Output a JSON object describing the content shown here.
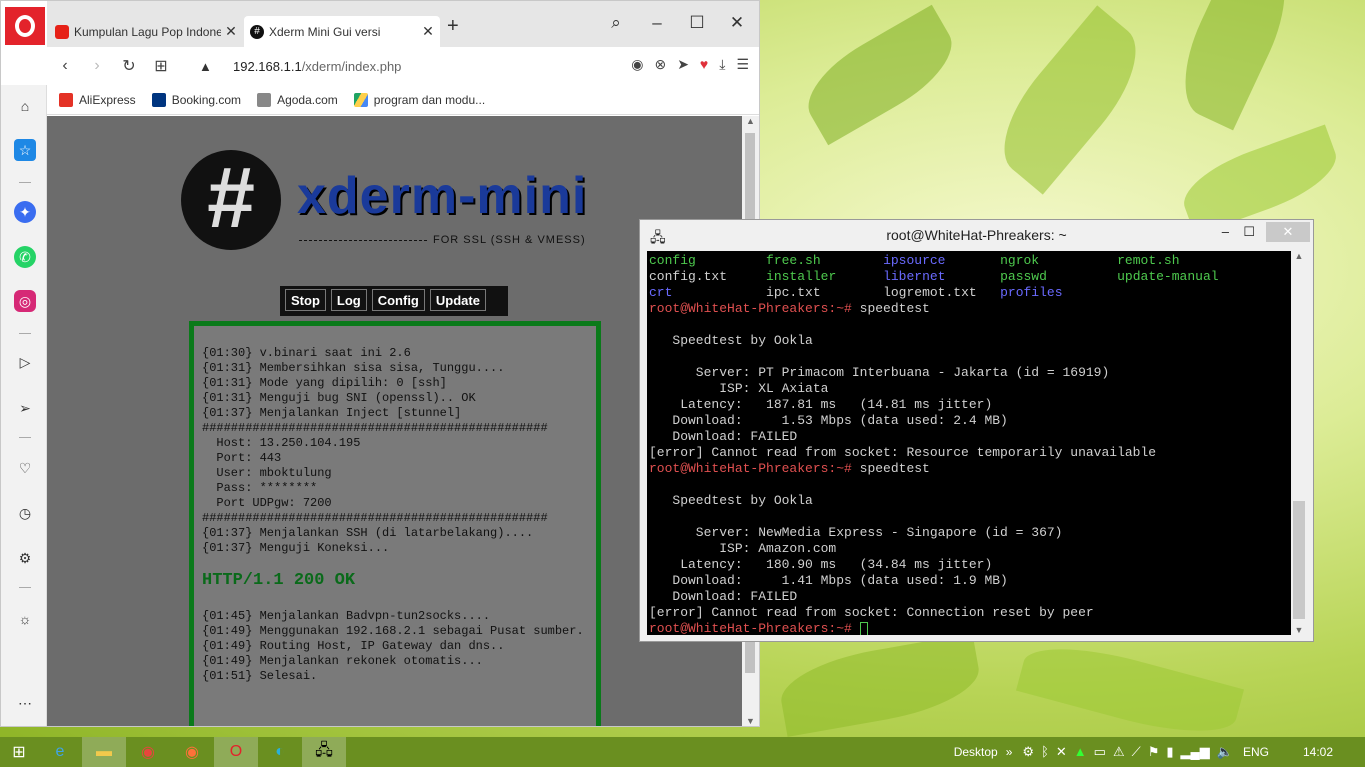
{
  "browser": {
    "tabs": [
      {
        "title": "Kumpulan Lagu Pop Indone",
        "favicon": "youtube-icon"
      },
      {
        "title": "Xderm Mini Gui versi",
        "favicon": "xderm-icon"
      }
    ],
    "new_tab": "+",
    "url_host": "192.168.1.1",
    "url_path": "/xderm/index.php",
    "bookmarks": [
      {
        "label": "AliExpress",
        "color": "#e43226"
      },
      {
        "label": "Booking.com",
        "color": "#003580"
      },
      {
        "label": "Agoda.com",
        "color": "#888888"
      },
      {
        "label": "program dan modu...",
        "color": "#1fa463"
      }
    ]
  },
  "xderm": {
    "logo_hash": "#",
    "title": "xderm-mini",
    "subtitle": "FOR SSL (SSH & VMESS)",
    "buttons": {
      "stop": "Stop",
      "log": "Log",
      "config": "Config",
      "update": "Update"
    },
    "log_lines_a": "{01:30} v.binari saat ini 2.6\n{01:31} Membersihkan sisa sisa, Tunggu....\n{01:31} Mode yang dipilih: 0 [ssh]\n{01:31} Menguji bug SNI (openssl).. OK\n{01:37} Menjalankan Inject [stunnel]\n################################################\n  Host: 13.250.104.195\n  Port: 443\n  User: mboktulung\n  Pass: ********\n  Port UDPgw: 7200\n################################################\n{01:37} Menjalankan SSH (di latarbelakang)....\n{01:37} Menguji Koneksi...",
    "http_status": "HTTP/1.1 200 OK",
    "log_lines_b": "\n{01:45} Menjalankan Badvpn-tun2socks....\n{01:49} Menggunakan 192.168.2.1 sebagai Pusat sumber.\n{01:49} Routing Host, IP Gateway dan dns..\n{01:49} Menjalankan rekonek otomatis...\n{01:51} Selesai."
  },
  "terminal": {
    "title": "root@WhiteHat-Phreakers: ~",
    "ls": [
      [
        {
          "t": "config",
          "c": "g"
        },
        {
          "t": "free.sh",
          "c": "g"
        },
        {
          "t": "ipsource",
          "c": "b"
        },
        {
          "t": "ngrok",
          "c": "g"
        },
        {
          "t": "remot.sh",
          "c": "g"
        }
      ],
      [
        {
          "t": "config.txt",
          "c": "w"
        },
        {
          "t": "installer",
          "c": "g"
        },
        {
          "t": "libernet",
          "c": "b"
        },
        {
          "t": "passwd",
          "c": "g"
        },
        {
          "t": "update-manual",
          "c": "g"
        }
      ],
      [
        {
          "t": "crt",
          "c": "b"
        },
        {
          "t": "ipc.txt",
          "c": "w"
        },
        {
          "t": "logremot.txt",
          "c": "w"
        },
        {
          "t": "profiles",
          "c": "b"
        },
        {
          "t": "",
          "c": "w"
        }
      ]
    ],
    "prompt": "root@WhiteHat-Phreakers:~#",
    "cmd": " speedtest",
    "run1": "\n   Speedtest by Ookla\n\n      Server: PT Primacom Interbuana - Jakarta (id = 16919)\n         ISP: XL Axiata\n    Latency:   187.81 ms   (14.81 ms jitter)\n   Download:     1.53 Mbps (data used: 2.4 MB)\n   Download: FAILED\n[error] Cannot read from socket: Resource temporarily unavailable",
    "run2": "\n   Speedtest by Ookla\n\n      Server: NewMedia Express - Singapore (id = 367)\n         ISP: Amazon.com\n    Latency:   180.90 ms   (34.84 ms jitter)\n   Download:     1.41 Mbps (data used: 1.9 MB)\n   Download: FAILED\n[error] Cannot read from socket: Connection reset by peer"
  },
  "taskbar": {
    "desktop_label": "Desktop",
    "language": "ENG",
    "time": "14:02"
  }
}
